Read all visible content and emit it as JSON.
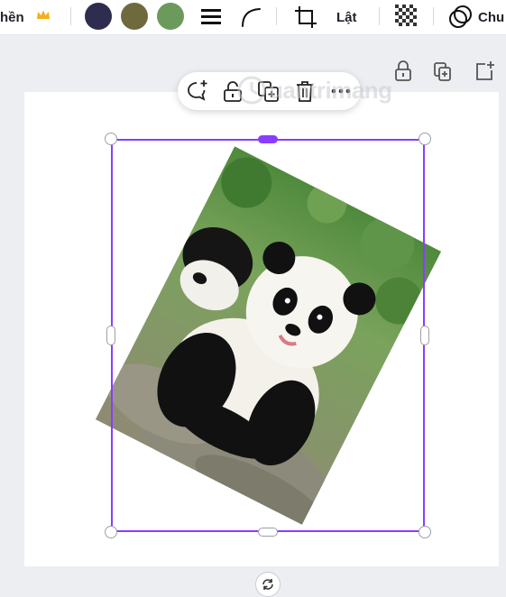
{
  "toolbar": {
    "left_label": "hền",
    "flip_label": "Lật",
    "right_label": "Chu",
    "swatches": [
      "#2e2c4f",
      "#6f6a3e",
      "#6b9a5c"
    ]
  },
  "colors": {
    "accent": "#8b3dff",
    "crown": "#f2b01e"
  },
  "icons": {
    "crown": "crown-icon",
    "lines": "line-weight-icon",
    "corner": "corner-rounding-icon",
    "crop": "crop-icon",
    "transparency": "transparency-icon",
    "layers": "layers-icon",
    "lock": "lock-icon",
    "duplicate": "duplicate-icon",
    "add_page": "add-page-icon",
    "comment": "comment-add-icon",
    "delete": "trash-icon",
    "more": "more-icon",
    "rotate": "rotate-icon"
  },
  "watermark": {
    "text": "uantrimang"
  },
  "image": {
    "subject": "panda"
  }
}
